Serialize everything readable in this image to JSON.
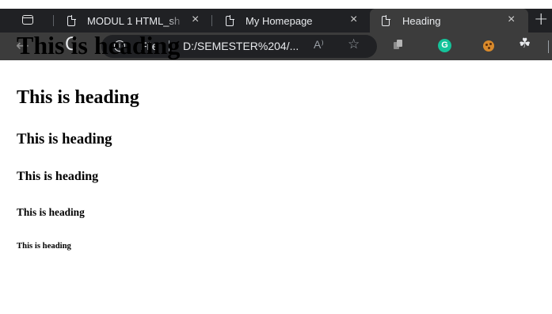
{
  "browser": {
    "tabs": [
      {
        "title": "MODUL 1 HTML_sh",
        "close": "×",
        "active": false
      },
      {
        "title": "My Homepage",
        "close": "×",
        "active": false
      },
      {
        "title": "Heading",
        "close": "×",
        "active": true
      }
    ],
    "new_tab": "+",
    "toolbar": {
      "back_glyph": "←",
      "refresh_glyph": "C",
      "info_glyph": "i",
      "file_label": "File",
      "url": "D:/SEMESTER%204/...",
      "read_aloud_glyph": "A⁾",
      "favorite_glyph": "☆",
      "extensions": [
        {
          "icon": "tab-groups-extension-icon"
        },
        {
          "icon": "grammarly-icon",
          "glyph": "G",
          "color": "#15c39a"
        },
        {
          "icon": "cookie-icon",
          "color": "#d98a2b"
        },
        {
          "icon": "puzzle-icon",
          "glyph": "☘"
        }
      ]
    },
    "colors": {
      "tabbar": "#202124",
      "toolbar": "#3c3c3c",
      "text": "#e8eaed"
    }
  },
  "page": {
    "headings": [
      {
        "level": 1,
        "text": "This is heading"
      },
      {
        "level": 2,
        "text": "This is heading"
      },
      {
        "level": 3,
        "text": "This is heading"
      },
      {
        "level": 4,
        "text": "This is heading"
      },
      {
        "level": 5,
        "text": "This is heading"
      },
      {
        "level": 6,
        "text": "This is heading"
      }
    ]
  }
}
